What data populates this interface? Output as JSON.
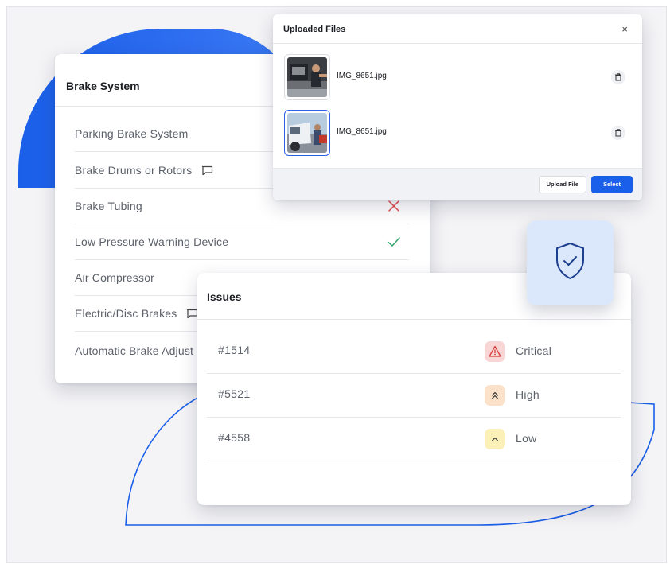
{
  "brake_system": {
    "title": "Brake System",
    "items": [
      {
        "label": "Parking Brake System",
        "comment": false,
        "status": "none"
      },
      {
        "label": "Brake Drums or Rotors",
        "comment": true,
        "status": "none"
      },
      {
        "label": "Brake Tubing",
        "comment": false,
        "status": "fail"
      },
      {
        "label": "Low Pressure Warning Device",
        "comment": false,
        "status": "pass"
      },
      {
        "label": "Air Compressor",
        "comment": false,
        "status": "none"
      },
      {
        "label": "Electric/Disc Brakes",
        "comment": true,
        "status": "none"
      },
      {
        "label": "Automatic Brake Adjust",
        "comment": false,
        "status": "none"
      }
    ]
  },
  "uploaded_files": {
    "title": "Uploaded Files",
    "close_label": "×",
    "files": [
      {
        "name": "IMG_8651.jpg",
        "selected": false
      },
      {
        "name": "IMG_8651.jpg",
        "selected": true
      }
    ],
    "upload_button": "Upload File",
    "select_button": "Select"
  },
  "issues": {
    "title": "Issues",
    "rows": [
      {
        "id": "#1514",
        "priority": "Critical",
        "icon": "warning-triangle-icon",
        "color": "#f9d6d6",
        "icon_color": "#d43c3c"
      },
      {
        "id": "#5521",
        "priority": "High",
        "icon": "double-chevron-up-icon",
        "color": "#fbe1c9",
        "icon_color": "#333333"
      },
      {
        "id": "#4558",
        "priority": "Low",
        "icon": "chevron-up-icon",
        "color": "#fbf1b8",
        "icon_color": "#333333"
      }
    ]
  },
  "colors": {
    "accent": "#1a5fe9",
    "fail": "#e5484d",
    "pass": "#30a46c"
  }
}
